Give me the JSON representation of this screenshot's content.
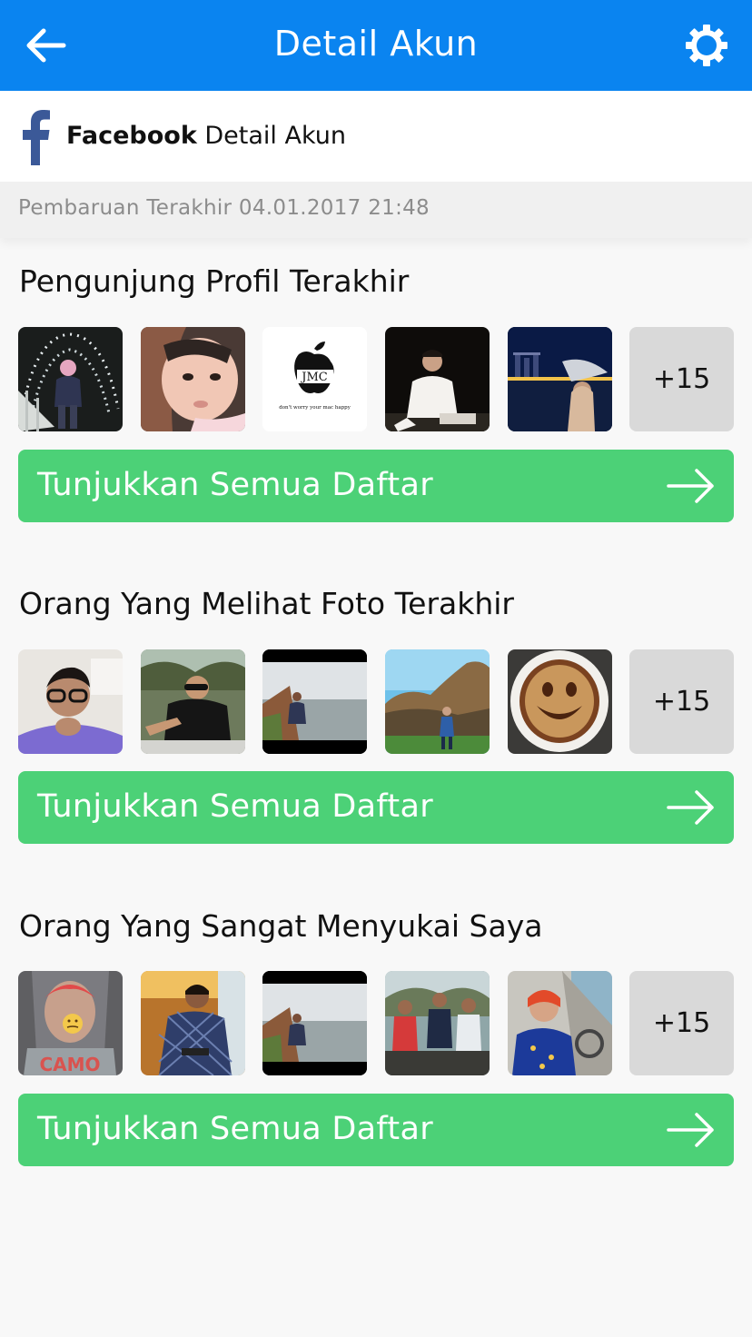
{
  "header": {
    "title": "Detail Akun",
    "back_icon": "arrow-left-icon",
    "settings_icon": "gear-icon"
  },
  "account": {
    "brand": "Facebook",
    "suffix": "Detail Akun",
    "icon": "facebook-icon"
  },
  "last_updated": "Pembaruan Terakhir 04.01.2017 21:48",
  "sections": [
    {
      "title": "Pengunjung Profil Terakhir",
      "photos": [
        "profile-photo-1",
        "profile-photo-2",
        "profile-photo-3",
        "profile-photo-4",
        "profile-photo-5"
      ],
      "jmc_logo": {
        "text": "JMC",
        "tagline": "don't worry your mac happy"
      },
      "more_count": "+15",
      "button_label": "Tunjukkan Semua Daftar"
    },
    {
      "title": "Orang Yang Melihat Foto Terakhir",
      "photos": [
        "profile-photo-1",
        "profile-photo-2",
        "profile-photo-3",
        "profile-photo-4",
        "profile-photo-5"
      ],
      "more_count": "+15",
      "button_label": "Tunjukkan Semua Daftar"
    },
    {
      "title": "Orang Yang Sangat Menyukai Saya",
      "photos": [
        "profile-photo-1",
        "profile-photo-2",
        "profile-photo-3",
        "profile-photo-4",
        "profile-photo-5"
      ],
      "shirt_text": "CAMO",
      "more_count": "+15",
      "button_label": "Tunjukkan Semua Daftar"
    }
  ],
  "colors": {
    "header": "#0a84f0",
    "button": "#4cd177",
    "facebook": "#3b5998",
    "more_tile": "#d9d9d9"
  }
}
